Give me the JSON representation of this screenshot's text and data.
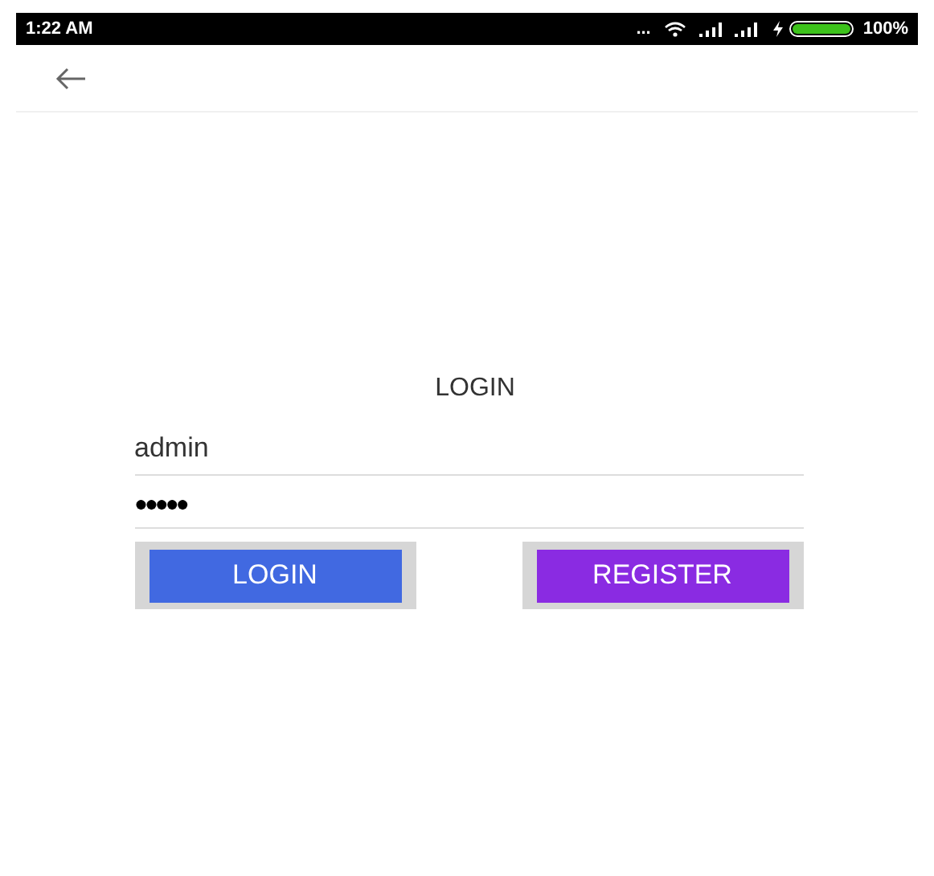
{
  "status_bar": {
    "time": "1:22 AM",
    "dots": "...",
    "battery_level": "100%"
  },
  "form": {
    "title": "LOGIN",
    "username": "admin",
    "password": "●●●●●"
  },
  "buttons": [
    {
      "label": "LOGIN",
      "kind": "login"
    },
    {
      "label": "REGISTER",
      "kind": "register"
    }
  ]
}
